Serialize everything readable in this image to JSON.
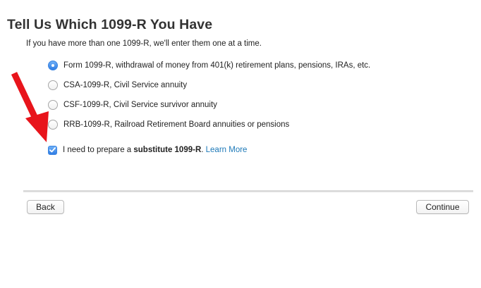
{
  "header": {
    "title": "Tell Us Which 1099-R You Have",
    "subtitle": "If you have more than one 1099-R, we'll enter them one at a time."
  },
  "options": [
    {
      "label": "Form 1099-R, withdrawal of money from 401(k) retirement plans, pensions, IRAs, etc.",
      "selected": true
    },
    {
      "label": "CSA-1099-R, Civil Service annuity",
      "selected": false
    },
    {
      "label": "CSF-1099-R, Civil Service survivor annuity",
      "selected": false
    },
    {
      "label": "RRB-1099-R, Railroad Retirement Board annuities or pensions",
      "selected": false
    }
  ],
  "substitute": {
    "checked": true,
    "prefix": "I need to prepare a ",
    "bold": "substitute 1099-R",
    "suffix": ". ",
    "link": "Learn More"
  },
  "buttons": {
    "back": "Back",
    "continue": "Continue"
  },
  "icons": {
    "annotation": "red-arrow-icon",
    "check": "checkmark-icon"
  },
  "colors": {
    "accent": "#2f7de4",
    "link": "#1d79b8",
    "annotation": "#e8141b"
  }
}
